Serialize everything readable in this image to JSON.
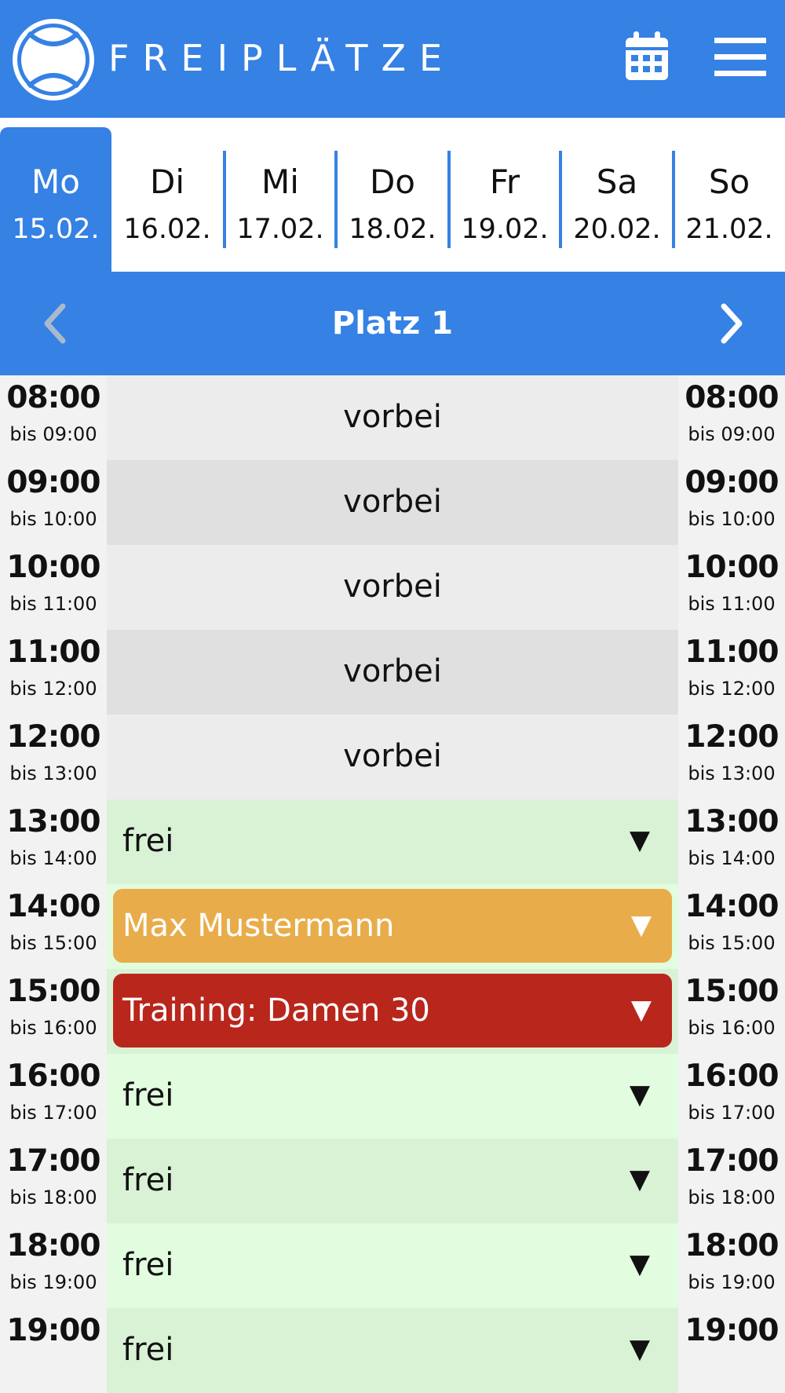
{
  "header": {
    "brand": "FREIPLÄTZE",
    "icons": {
      "logo": "tennis-ball-icon",
      "calendar": "calendar-icon",
      "menu": "hamburger-menu-icon"
    },
    "color": "#3581e4"
  },
  "days": [
    {
      "name": "Mo",
      "date": "15.02.",
      "active": true
    },
    {
      "name": "Di",
      "date": "16.02."
    },
    {
      "name": "Mi",
      "date": "17.02."
    },
    {
      "name": "Do",
      "date": "18.02."
    },
    {
      "name": "Fr",
      "date": "19.02."
    },
    {
      "name": "Sa",
      "date": "20.02."
    },
    {
      "name": "So",
      "date": "21.02."
    }
  ],
  "court": {
    "title": "Platz 1",
    "prev_icon": "chevron-left-icon",
    "next_icon": "chevron-right-icon"
  },
  "slots": [
    {
      "start": "08:00",
      "end": "bis 09:00",
      "status": "past",
      "label": "vorbei"
    },
    {
      "start": "09:00",
      "end": "bis 10:00",
      "status": "past",
      "label": "vorbei"
    },
    {
      "start": "10:00",
      "end": "bis 11:00",
      "status": "past",
      "label": "vorbei"
    },
    {
      "start": "11:00",
      "end": "bis 12:00",
      "status": "past",
      "label": "vorbei"
    },
    {
      "start": "12:00",
      "end": "bis 13:00",
      "status": "past",
      "label": "vorbei"
    },
    {
      "start": "13:00",
      "end": "bis 14:00",
      "status": "free",
      "label": "frei"
    },
    {
      "start": "14:00",
      "end": "bis 15:00",
      "status": "booked",
      "label": "Max Mustermann"
    },
    {
      "start": "15:00",
      "end": "bis 16:00",
      "status": "training",
      "label": "Training: Damen 30"
    },
    {
      "start": "16:00",
      "end": "bis 17:00",
      "status": "free",
      "label": "frei"
    },
    {
      "start": "17:00",
      "end": "bis 18:00",
      "status": "free",
      "label": "frei"
    },
    {
      "start": "18:00",
      "end": "bis 19:00",
      "status": "free",
      "label": "frei"
    },
    {
      "start": "19:00",
      "end": "",
      "status": "free",
      "label": "frei"
    }
  ],
  "arrow_glyph": "▼",
  "colors": {
    "booked": "#e8ad4a",
    "training": "#b9261c",
    "free": "#e1fcdf",
    "past": "#ececec"
  }
}
